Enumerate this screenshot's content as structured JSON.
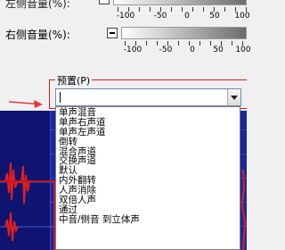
{
  "dialog": {
    "top_label_partial": "左侧音量(%):",
    "right_volume_label": "右侧音量(%):",
    "top_scale": [
      "-100",
      "-50",
      "0",
      "50",
      "100"
    ],
    "right_scale": [
      "-100",
      "-50",
      "0",
      "50",
      "100"
    ]
  },
  "preset": {
    "group_label": "预置(P)",
    "combo_value": "",
    "options": [
      "单声混音",
      "单声右声道",
      "单声左声道",
      "倒转",
      "混合声道",
      "交换声道",
      "默认",
      "内外翻转",
      "人声消除",
      "双倍人声",
      "通过",
      "中音/侧音 到立体声"
    ]
  },
  "colors": {
    "highlight_border": "#d21e1e",
    "waveform_bg": "#1a28a0",
    "waveform_signal": "#e01e1e"
  }
}
